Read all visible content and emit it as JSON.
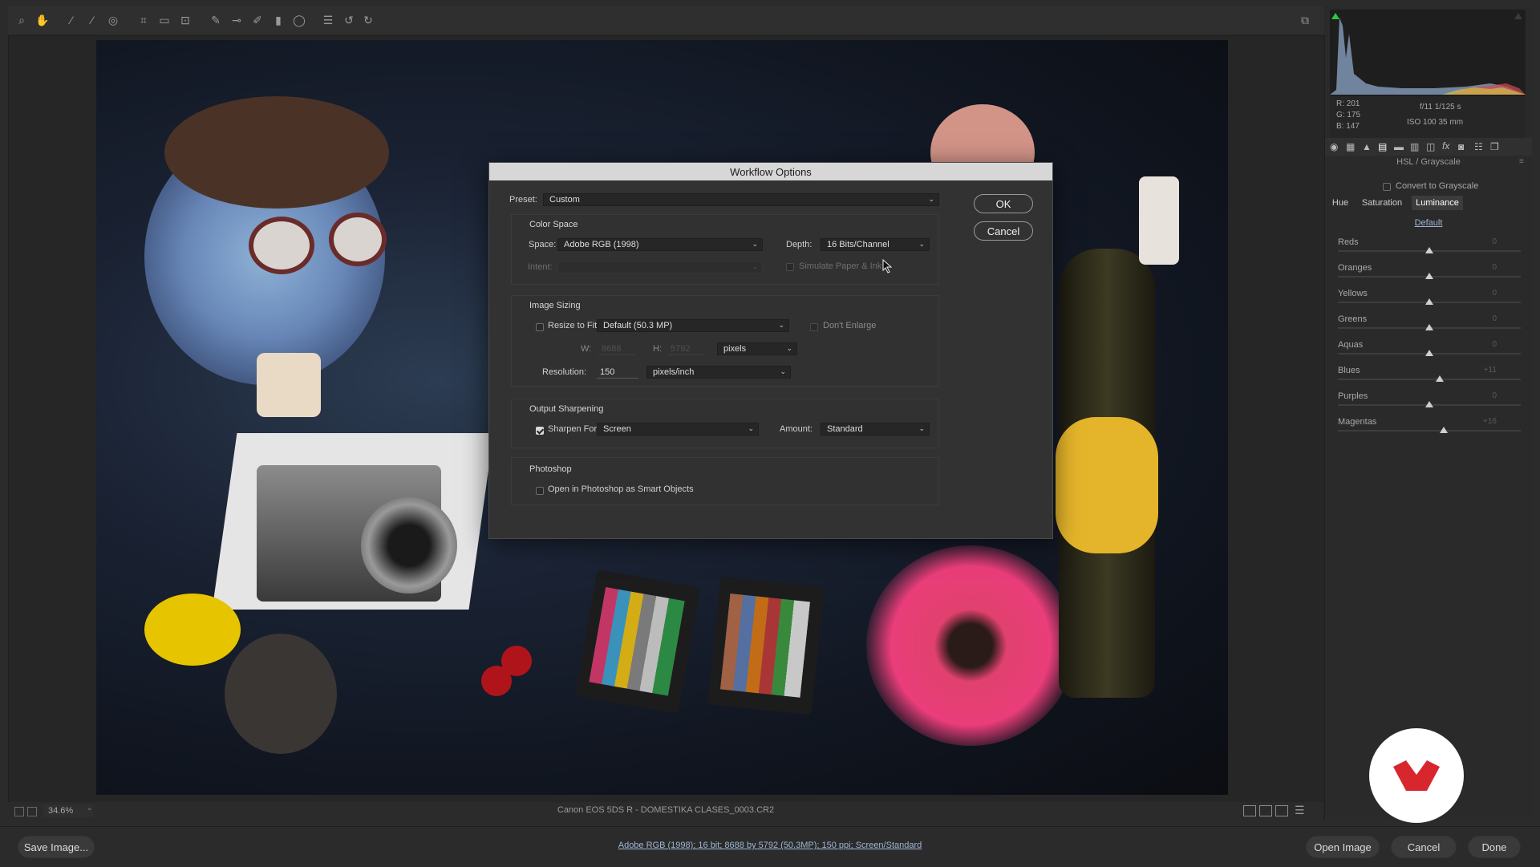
{
  "toolbar": {
    "tools": [
      "zoom-tool-icon",
      "hand-tool-icon",
      "white-balance-tool-icon",
      "color-sampler-tool-icon",
      "targeted-adjustment-tool-icon",
      "crop-tool-icon",
      "straighten-tool-icon",
      "transform-tool-icon",
      "spot-removal-tool-icon",
      "red-eye-tool-icon",
      "adjustment-brush-icon",
      "graduated-filter-icon",
      "radial-filter-icon",
      "preferences-list-icon",
      "rotate-left-icon",
      "rotate-right-icon"
    ]
  },
  "status": {
    "zoom": "34.6%",
    "filename": "Canon EOS 5DS R  -  DOMESTIKA CLASES_0003.CR2"
  },
  "bottom": {
    "save_label": "Save Image...",
    "workflow_link": "Adobe RGB (1998); 16 bit; 8688 by 5792 (50.3MP); 150 ppi; Screen/Standard",
    "open_label": "Open Image",
    "cancel_label": "Cancel",
    "done_label": "Done"
  },
  "readout": {
    "r": "R:  201",
    "g": "G:  175",
    "b": "B:  147",
    "aperture_shutter": "f/11   1/125 s",
    "iso_lens": "ISO 100   35 mm"
  },
  "panel": {
    "title": "HSL / Grayscale",
    "convert_label": "Convert to Grayscale",
    "tabs": [
      "Hue",
      "Saturation",
      "Luminance"
    ],
    "active_tab": "Luminance",
    "default_link": "Default",
    "sliders": [
      {
        "label": "Reds",
        "value": "0",
        "pos": 0.5
      },
      {
        "label": "Oranges",
        "value": "0",
        "pos": 0.5
      },
      {
        "label": "Yellows",
        "value": "0",
        "pos": 0.5
      },
      {
        "label": "Greens",
        "value": "0",
        "pos": 0.5
      },
      {
        "label": "Aquas",
        "value": "0",
        "pos": 0.5
      },
      {
        "label": "Blues",
        "value": "+11",
        "pos": 0.555
      },
      {
        "label": "Purples",
        "value": "0",
        "pos": 0.5
      },
      {
        "label": "Magentas",
        "value": "+16",
        "pos": 0.58
      }
    ]
  },
  "dialog": {
    "title": "Workflow Options",
    "preset_label": "Preset:",
    "preset_value": "Custom",
    "ok": "OK",
    "cancel": "Cancel",
    "color_space": {
      "title": "Color Space",
      "space_label": "Space:",
      "space_value": "Adobe RGB (1998)",
      "depth_label": "Depth:",
      "depth_value": "16 Bits/Channel",
      "intent_label": "Intent:",
      "simulate_label": "Simulate Paper & Ink"
    },
    "image_sizing": {
      "title": "Image Sizing",
      "resize_label": "Resize to Fit:",
      "resize_value": "Default  (50.3 MP)",
      "dont_enlarge": "Don't Enlarge",
      "w_label": "W:",
      "w_value": "8688",
      "h_label": "H:",
      "h_value": "5792",
      "unit_value": "pixels",
      "resolution_label": "Resolution:",
      "resolution_value": "150",
      "resolution_unit": "pixels/inch"
    },
    "sharpening": {
      "title": "Output Sharpening",
      "sharpen_label": "Sharpen For:",
      "sharpen_value": "Screen",
      "amount_label": "Amount:",
      "amount_value": "Standard"
    },
    "photoshop": {
      "title": "Photoshop",
      "smart_objects_label": "Open in Photoshop as Smart Objects"
    }
  },
  "colors": {
    "accent_red": "#d8262f",
    "dialog_bg": "#323232"
  }
}
